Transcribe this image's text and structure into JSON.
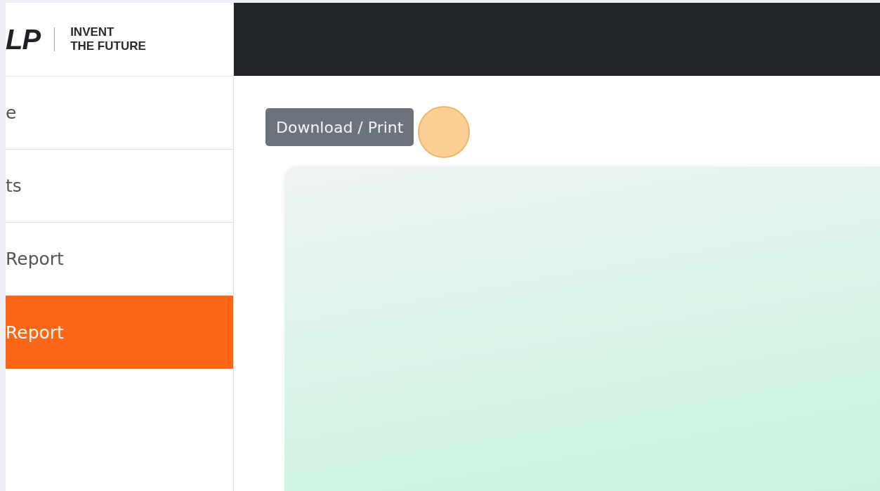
{
  "logo": {
    "mark": "LP",
    "tagline": [
      "INVENT",
      "THE FUTURE"
    ]
  },
  "sidebar": {
    "items": [
      {
        "label": "e",
        "selected": false
      },
      {
        "label": "ts",
        "selected": false
      },
      {
        "label": "Report",
        "selected": false
      },
      {
        "label": "Report",
        "selected": true
      }
    ]
  },
  "main": {
    "button": "Download / Print"
  }
}
